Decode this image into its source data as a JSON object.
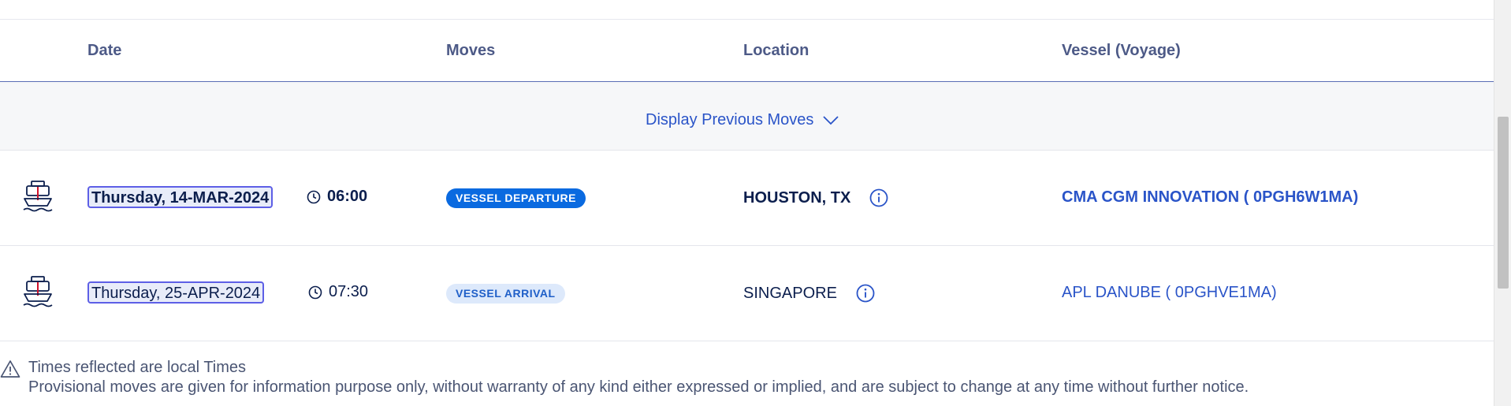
{
  "table": {
    "headers": {
      "date": "Date",
      "moves": "Moves",
      "location": "Location",
      "vessel": "Vessel (Voyage)"
    },
    "display_previous_label": "Display Previous Moves",
    "rows": [
      {
        "icon": "ship-icon",
        "date": "Thursday, 14-MAR-2024",
        "time": "06:00",
        "move": "VESSEL DEPARTURE",
        "location": "HOUSTON, TX",
        "vessel": "CMA CGM INNOVATION ( 0PGH6W1MA)",
        "status_color": "#0a6ae0"
      },
      {
        "icon": "ship-icon",
        "date": "Thursday, 25-APR-2024",
        "time": "07:30",
        "move": "VESSEL ARRIVAL",
        "location": "SINGAPORE",
        "vessel": "APL DANUBE ( 0PGHVE1MA)",
        "status_color": "#dde9fb"
      }
    ]
  },
  "notes": {
    "icon": "warning-icon",
    "line1": "Times reflected are local Times",
    "line2": "Provisional moves are given for information purpose only, without warranty of any kind either expressed or implied, and are subject to change at any time without further notice."
  },
  "colors": {
    "link": "#2a54c8",
    "text": "#0b1e4d",
    "header_text": "#4d5a87",
    "accent_border": "#5d5fe6"
  }
}
